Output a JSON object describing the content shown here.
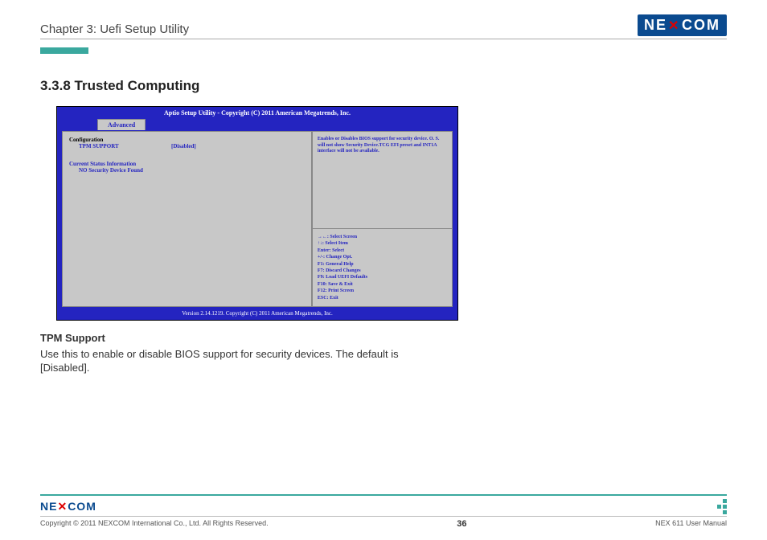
{
  "header": {
    "chapter": "Chapter 3: Uefi Setup Utility",
    "brand": "NE COM"
  },
  "section": {
    "number_title": "3.3.8 Trusted Computing"
  },
  "bios": {
    "title": "Aptio Setup Utility - Copyright (C) 2011 American Megatrends, Inc.",
    "tab": "Advanced",
    "config_head": "Configuration",
    "tpm_label": "TPM SUPPORT",
    "tpm_value": "[Disabled]",
    "status_head": "Current Status Information",
    "status_value": "NO Security Device Found",
    "help_text": "Enables or Disables BIOS support for security device. O. S. will not show Security Device.TCG EFI preset and INT1A interface will not be available.",
    "keys": [
      "→←: Select Screen",
      "↑↓: Select Item",
      "Enter: Select",
      "+/-: Change Opt.",
      "F1: General Help",
      "F7: Discard Changes",
      "F9: Load UEFI Defaults",
      "F10: Save & Exit",
      "F12: Print Screen",
      "ESC: Exit"
    ],
    "footer": "Version 2.14.1219. Copyright (C) 2011 American Megatrends, Inc."
  },
  "body": {
    "subhead": "TPM Support",
    "text": "Use this to enable or disable BIOS support for security devices. The default is [Disabled]."
  },
  "footer": {
    "copyright": "Copyright © 2011 NEXCOM International Co., Ltd. All Rights Reserved.",
    "page": "36",
    "manual": "NEX 611 User Manual"
  }
}
